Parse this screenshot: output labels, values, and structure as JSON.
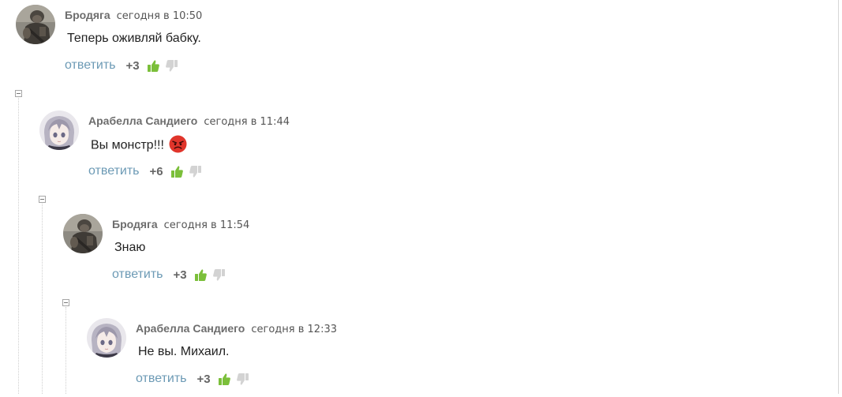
{
  "comments": [
    {
      "author": "Бродяга",
      "date": "сегодня в 10:50",
      "text": "Теперь оживляй бабку.",
      "reply_label": "ответить",
      "score": "+3",
      "avatar_icon": "soldier-avatar",
      "emoji": null
    },
    {
      "author": "Арабелла Сандиего",
      "date": "сегодня в 11:44",
      "text": "Вы монстр!!!",
      "reply_label": "ответить",
      "score": "+6",
      "avatar_icon": "anime-girl-avatar",
      "emoji": "angry-face-emoji"
    },
    {
      "author": "Бродяга",
      "date": "сегодня в 11:54",
      "text": "Знаю",
      "reply_label": "ответить",
      "score": "+3",
      "avatar_icon": "soldier-avatar",
      "emoji": null
    },
    {
      "author": "Арабелла Сандиего",
      "date": "сегодня в 12:33",
      "text": "Не вы. Михаил.",
      "reply_label": "ответить",
      "score": "+3",
      "avatar_icon": "anime-girl-avatar",
      "emoji": null
    }
  ],
  "colors": {
    "reply_link": "#6c9ab5",
    "upvote_active": "#7bbf3a",
    "downvote_inactive": "#d3d3d3",
    "author": "#6d6d6d",
    "emoji_red": "#e0352b"
  },
  "icons": {
    "upvote": "thumbs-up-icon",
    "downvote": "thumbs-down-icon",
    "collapse": "collapse-minus-icon"
  }
}
